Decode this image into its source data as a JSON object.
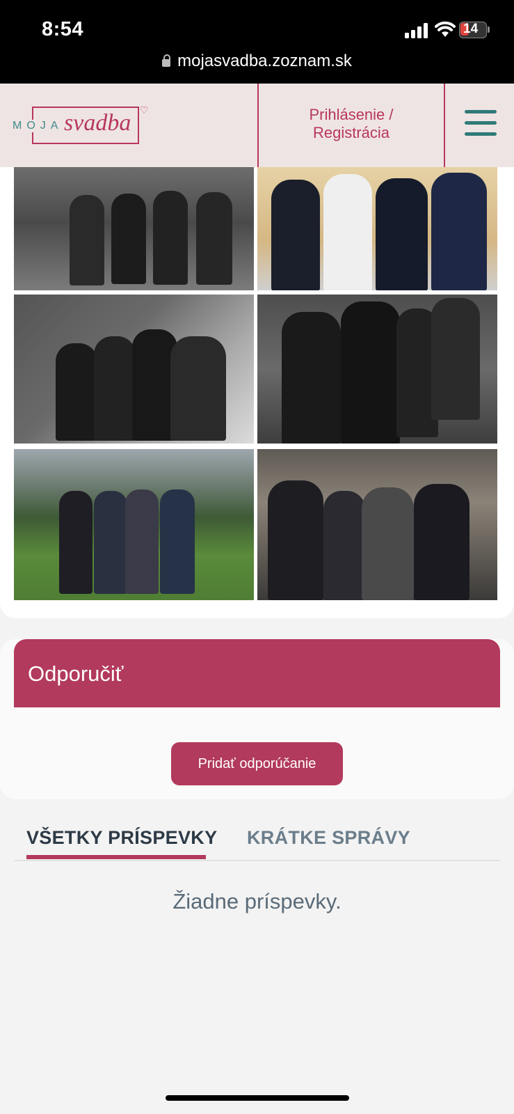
{
  "status_bar": {
    "time": "8:54",
    "battery_level": "14",
    "url": "mojasvadba.zoznam.sk"
  },
  "header": {
    "logo_moja": "MOJA",
    "logo_svadba": "svadba",
    "login_line1": "Prihlásenie /",
    "login_line2": "Registrácia"
  },
  "recommend": {
    "title": "Odporučiť",
    "button_label": "Pridať odporúčanie"
  },
  "tabs": [
    {
      "label": "VŠETKY PRÍSPEVKY",
      "active": true
    },
    {
      "label": "KRÁTKE SPRÁVY",
      "active": false
    }
  ],
  "empty_message": "Žiadne príspevky.",
  "colors": {
    "brand": "#b23a5c",
    "teal": "#2f7a78",
    "header_bg": "#efe4e4"
  }
}
